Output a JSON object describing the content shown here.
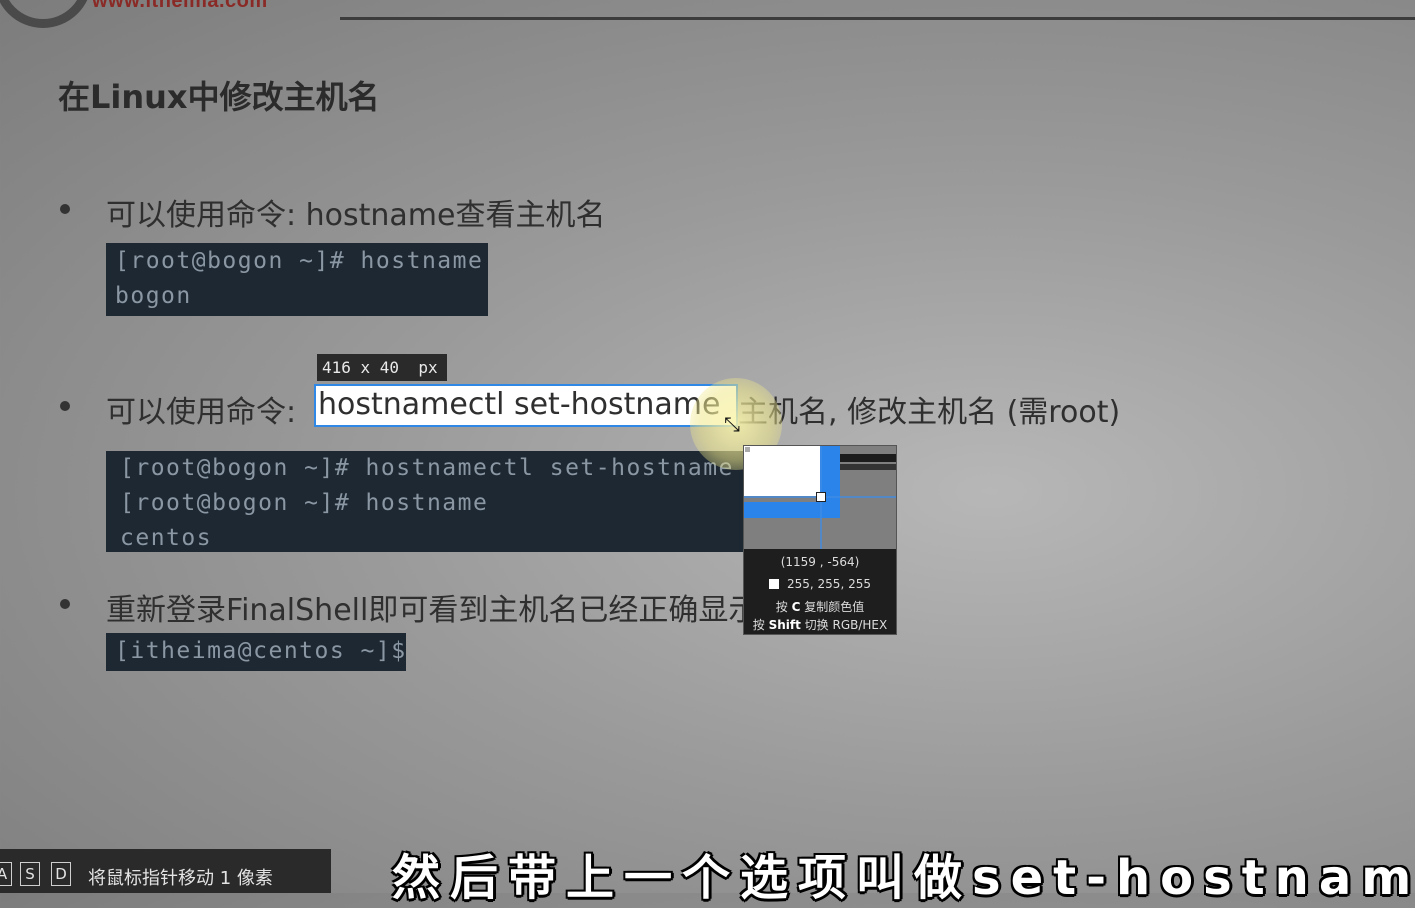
{
  "header": {
    "url": "www.itheima.com"
  },
  "slide": {
    "title": "在Linux中修改主机名",
    "bullets": [
      {
        "text": "可以使用命令: hostname查看主机名",
        "terminal": [
          "[root@bogon ~]# hostname",
          "bogon"
        ]
      },
      {
        "prefix": "可以使用命令: ",
        "highlight": "hostnamectl set-hostname",
        "suffix": "主机名, 修改主机名 (需root)",
        "terminal": [
          "[root@bogon ~]# hostnamectl set-hostname",
          "[root@bogon ~]# hostname",
          "centos"
        ]
      },
      {
        "text": "重新登录FinalShell即可看到主机名已经正确显示",
        "terminal": [
          "[itheima@centos ~]$"
        ]
      }
    ]
  },
  "screenshot_tool": {
    "size_label": "416 x 40  px",
    "picker": {
      "coords": "(1159 , -564)",
      "rgb": "255, 255, 255",
      "swatch_color": "#ffffff",
      "copy_hint": {
        "prefix": "按 ",
        "key": "C",
        "suffix": " 复制颜色值"
      },
      "switch_hint": {
        "prefix": "按 ",
        "key": "Shift",
        "suffix": " 切换 RGB/HEX"
      }
    },
    "selection_color": "#2f88e6"
  },
  "key_hint": {
    "keys": [
      "A",
      "S",
      "D"
    ],
    "text": "将鼠标指针移动 1 像素"
  },
  "subtitle": "然后带上一个选项叫做set-hostname"
}
